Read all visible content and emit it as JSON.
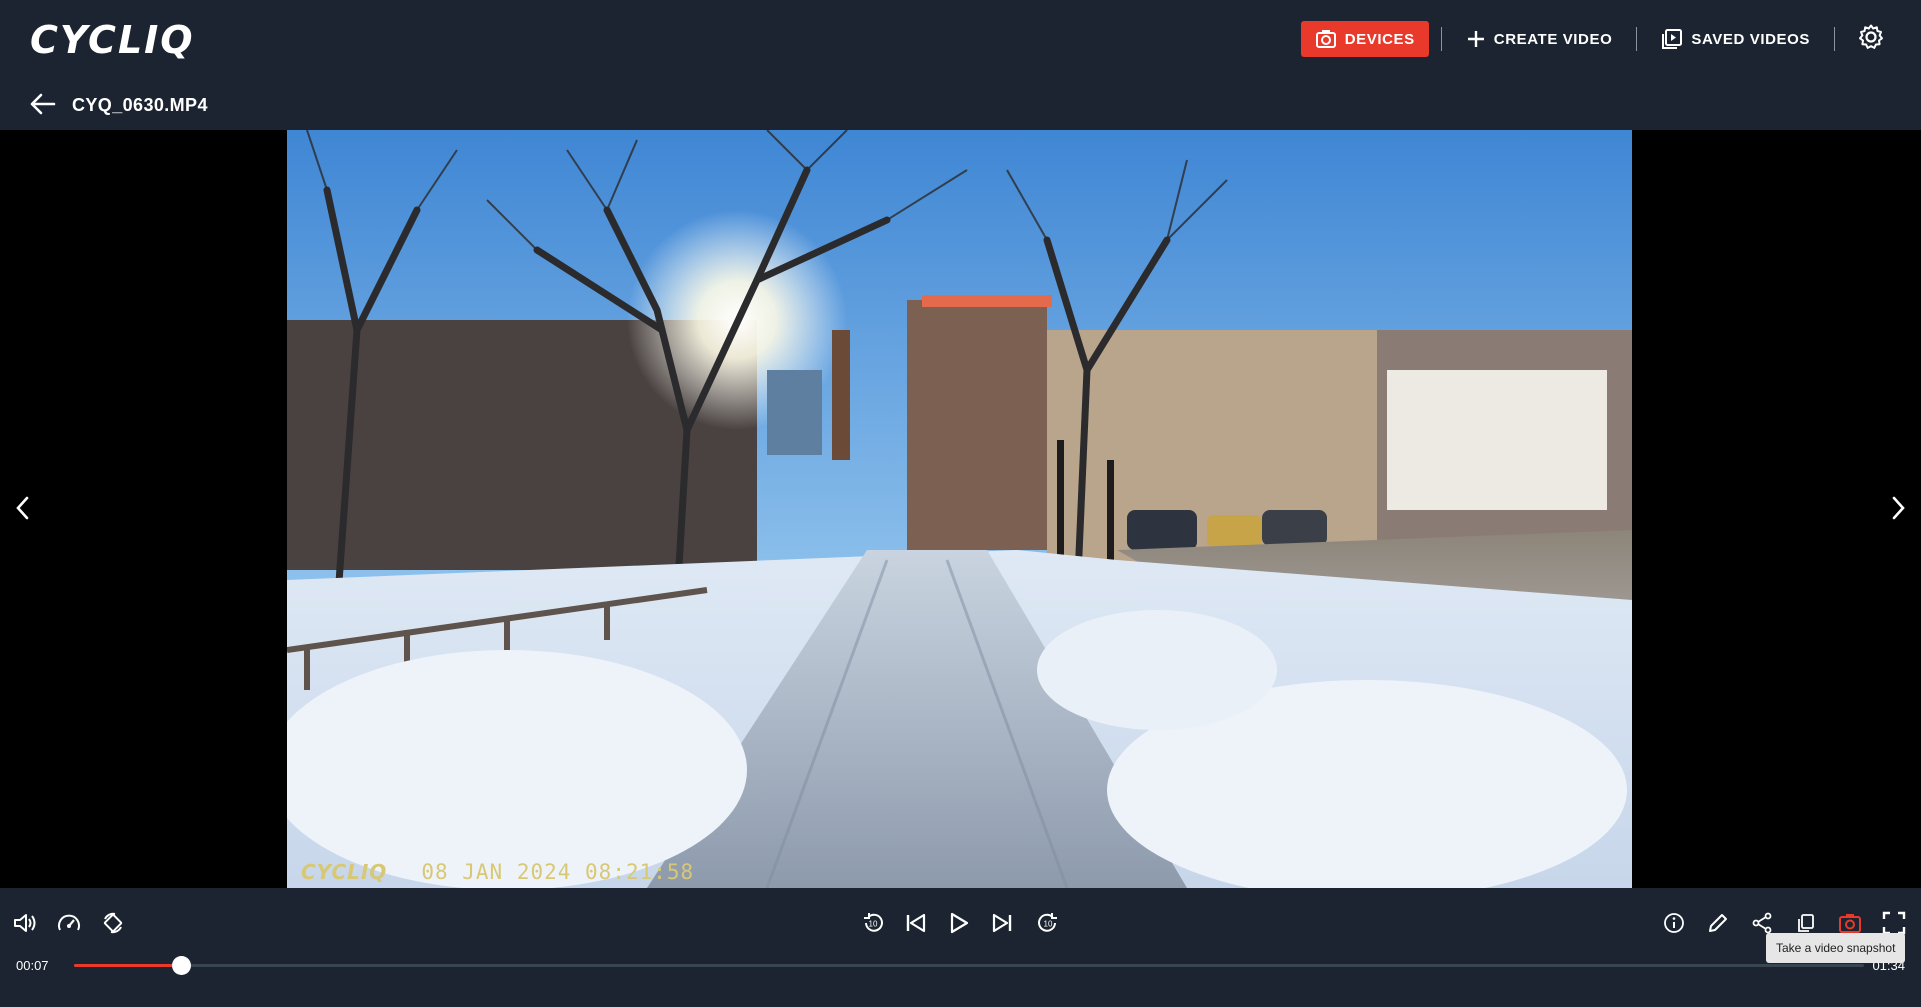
{
  "header": {
    "logo_text": "CYCLIQ",
    "nav": {
      "devices_label": "DEVICES",
      "create_video_label": "CREATE VIDEO",
      "saved_videos_label": "SAVED VIDEOS"
    },
    "icons": [
      "camera-icon",
      "plus-icon",
      "play-square-icon",
      "gear-icon"
    ]
  },
  "file": {
    "name": "CYQ_0630.MP4"
  },
  "video": {
    "osd_logo": "CYCLIQ",
    "osd_timestamp": "08 JAN 2024 08:21:58"
  },
  "player": {
    "current_time": "00:07",
    "duration": "01:34",
    "progress_fraction": 0.06,
    "tooltip": "Take a video snapshot",
    "accent_color": "#e8392b"
  }
}
